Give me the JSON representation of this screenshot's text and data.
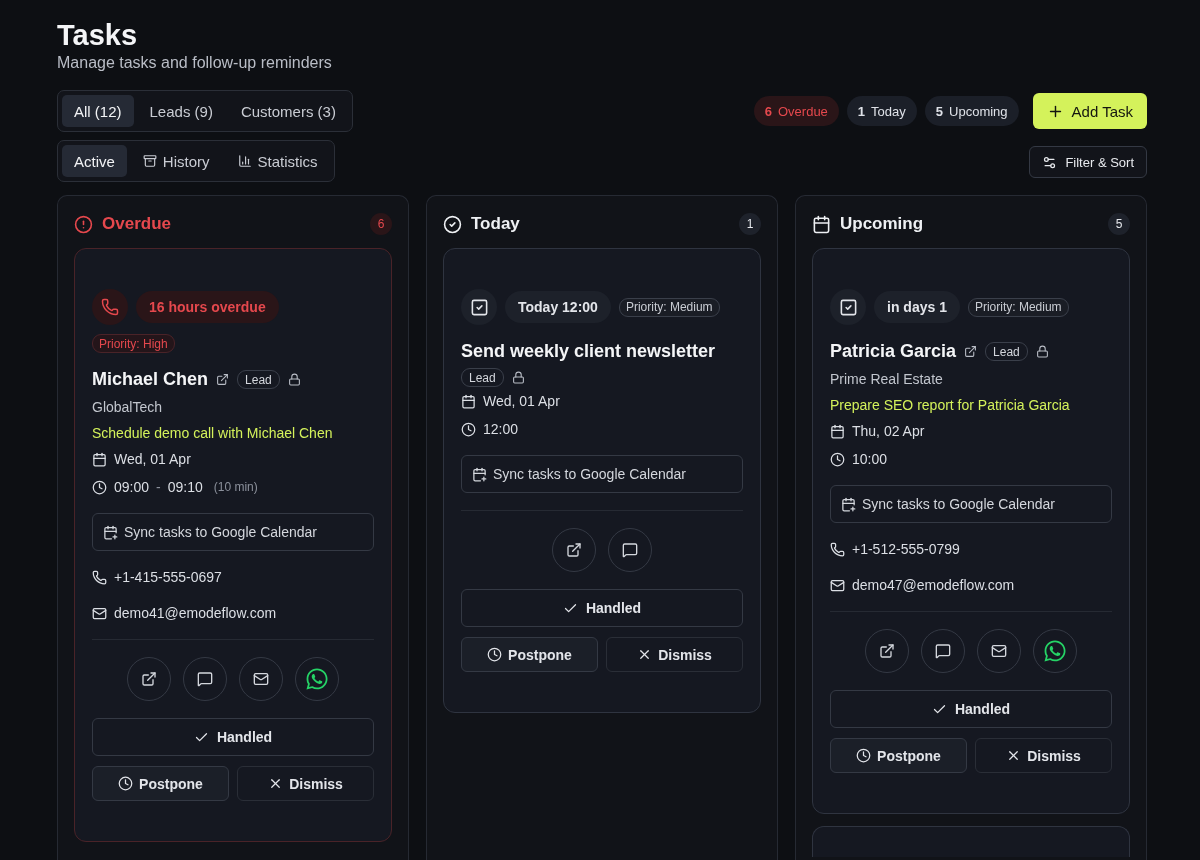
{
  "header": {
    "title": "Tasks",
    "subtitle": "Manage tasks and follow-up reminders"
  },
  "filter_tabs": [
    {
      "label": "All (12)",
      "selected": true
    },
    {
      "label": "Leads (9)",
      "selected": false
    },
    {
      "label": "Customers (3)",
      "selected": false
    }
  ],
  "view_tabs": [
    {
      "label": "Active",
      "selected": true,
      "kind": "active"
    },
    {
      "label": "History",
      "selected": false,
      "kind": "history"
    },
    {
      "label": "Statistics",
      "selected": false,
      "kind": "statistics"
    }
  ],
  "summary": [
    {
      "count": "6",
      "label": "Overdue",
      "kind": "overdue"
    },
    {
      "count": "1",
      "label": "Today",
      "kind": "today"
    },
    {
      "count": "5",
      "label": "Upcoming",
      "kind": "upcoming"
    }
  ],
  "add_button": "Add Task",
  "filter_button": "Filter & Sort",
  "columns": [
    {
      "kind": "overdue",
      "title": "Overdue",
      "count": "6",
      "more_below": false,
      "cards": [
        {
          "kind": "call",
          "due": "16 hours overdue",
          "priority": {
            "label": "Priority: High",
            "urgent": true
          },
          "contact": "Michael Chen",
          "tag": "Lead",
          "company": "GlobalTech",
          "task": "Schedule demo call with Michael Chen",
          "date": "Wed, 01 Apr",
          "time": "09:00",
          "time_separator": "-",
          "time_end": "09:10",
          "duration": "(10 min)",
          "sync": "Sync tasks to Google Calendar",
          "phone": "+1-415-555-0697",
          "email": "demo41@emodeflow.com",
          "quick_actions": [
            {
              "kind": "open"
            },
            {
              "kind": "chat"
            },
            {
              "kind": "email"
            },
            {
              "kind": "whatsapp"
            }
          ],
          "handled": "Handled",
          "postpone": "Postpone",
          "dismiss": "Dismiss"
        }
      ]
    },
    {
      "kind": "today",
      "title": "Today",
      "count": "1",
      "more_below": false,
      "cards": [
        {
          "kind": "task",
          "due": "Today 12:00",
          "priority": {
            "label": "Priority: Medium",
            "urgent": false
          },
          "title": "Send weekly client newsletter",
          "tag": "Lead",
          "date": "Wed, 01 Apr",
          "time": "12:00",
          "sync": "Sync tasks to Google Calendar",
          "quick_actions": [
            {
              "kind": "open"
            },
            {
              "kind": "chat"
            }
          ],
          "handled": "Handled",
          "postpone": "Postpone",
          "dismiss": "Dismiss"
        }
      ]
    },
    {
      "kind": "upcoming",
      "title": "Upcoming",
      "count": "5",
      "more_below": true,
      "cards": [
        {
          "kind": "task",
          "due": "in days 1",
          "priority": {
            "label": "Priority: Medium",
            "urgent": false
          },
          "contact": "Patricia Garcia",
          "tag": "Lead",
          "company": "Prime Real Estate",
          "task": "Prepare SEO report for Patricia Garcia",
          "date": "Thu, 02 Apr",
          "time": "10:00",
          "sync": "Sync tasks to Google Calendar",
          "phone": "+1-512-555-0799",
          "email": "demo47@emodeflow.com",
          "quick_actions": [
            {
              "kind": "open"
            },
            {
              "kind": "chat"
            },
            {
              "kind": "email"
            },
            {
              "kind": "whatsapp"
            }
          ],
          "handled": "Handled",
          "postpone": "Postpone",
          "dismiss": "Dismiss"
        }
      ]
    }
  ]
}
